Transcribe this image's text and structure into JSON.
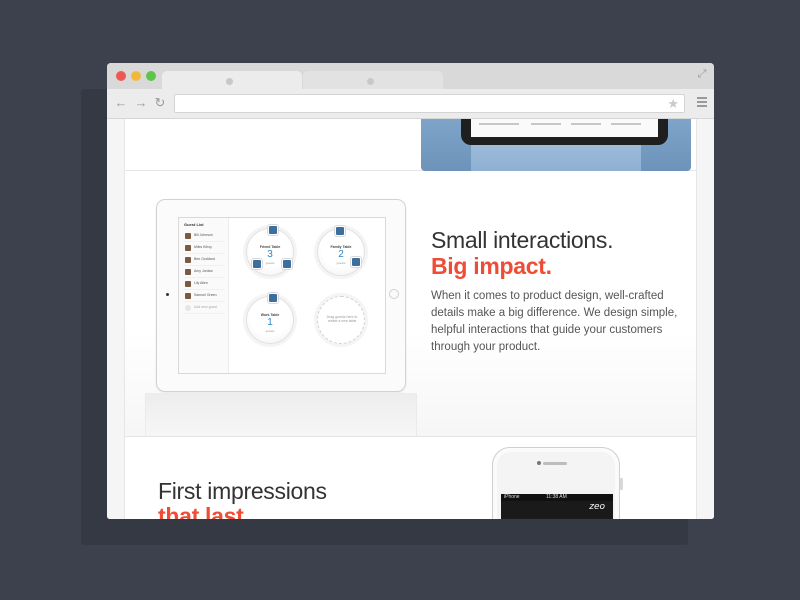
{
  "browser": {
    "controls": {
      "close": "close",
      "minimize": "minimize",
      "zoom": "zoom"
    },
    "toolbar": {
      "back_icon": "←",
      "forward_icon": "→",
      "reload_icon": "↻",
      "url": "",
      "star_icon": "★",
      "expand_icon": "⤢"
    }
  },
  "section_interactions": {
    "heading": "Small interactions.",
    "heading_accent": "Big impact.",
    "body": "When it comes to product design, well-crafted details make a big difference. We design simple, helpful interactions that guide your customers through your product.",
    "ipad": {
      "guest_list_title": "Guest List",
      "guests": [
        "Bill Johnson",
        "Miles Kilroy",
        "Ben Goddard",
        "Amy Jordan",
        "Lily Allen",
        "Samuel Green"
      ],
      "add_guest": "Add new guest",
      "tables": [
        {
          "name": "Friend Table",
          "count": "3",
          "unit": "guests"
        },
        {
          "name": "Family Table",
          "count": "2",
          "unit": "guests"
        },
        {
          "name": "Work Table",
          "count": "1",
          "unit": "guests"
        }
      ],
      "drop_hint": "Drag guests here to create a new table"
    }
  },
  "section_impressions": {
    "heading": "First impressions",
    "heading_accent": "that last.",
    "iphone": {
      "carrier": "iPhone",
      "time": "11:38 AM",
      "logo": "zeo"
    }
  },
  "colors": {
    "accent": "#ef4c36",
    "background": "#3d414d",
    "text": "#333333"
  }
}
